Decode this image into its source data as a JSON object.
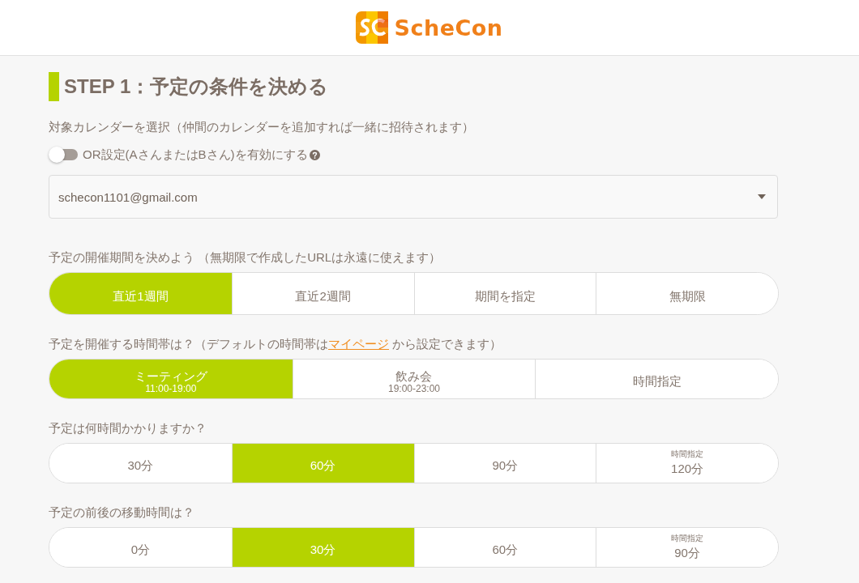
{
  "header": {
    "logo_text": "ScheCon"
  },
  "step": {
    "title": "STEP 1：予定の条件を決める"
  },
  "calendar": {
    "label": "対象カレンダーを選択（仲間のカレンダーを追加すれば一緒に招待されます）",
    "or_toggle": {
      "label": "OR設定(AさんまたはBさん)を有効にする",
      "on": false
    },
    "select": {
      "value": "schecon1101@gmail.com"
    }
  },
  "period": {
    "label": "予定の開催期間を決めよう （無期限で作成したURLは永遠に使えます）",
    "options": [
      {
        "label": "直近1週間",
        "selected": true
      },
      {
        "label": "直近2週間",
        "selected": false
      },
      {
        "label": "期間を指定",
        "selected": false
      },
      {
        "label": "無期限",
        "selected": false
      }
    ]
  },
  "time_slot": {
    "label_before": "予定を開催する時間帯は？（デフォルトの時間帯は",
    "link": "マイページ",
    "label_after": " から設定できます）",
    "options": [
      {
        "label": "ミーティング",
        "sub": "11:00-19:00",
        "selected": true
      },
      {
        "label": "飲み会",
        "sub": "19:00-23:00",
        "selected": false
      },
      {
        "label": "時間指定",
        "selected": false
      }
    ]
  },
  "duration": {
    "label": "予定は何時間かかりますか？",
    "options": [
      {
        "label": "30分",
        "selected": false
      },
      {
        "label": "60分",
        "selected": true
      },
      {
        "label": "90分",
        "selected": false
      },
      {
        "caption": "時間指定",
        "label": "120分",
        "selected": false
      }
    ]
  },
  "travel": {
    "label": "予定の前後の移動時間は？",
    "options": [
      {
        "label": "0分",
        "selected": false
      },
      {
        "label": "30分",
        "selected": true
      },
      {
        "label": "60分",
        "selected": false
      },
      {
        "caption": "時間指定",
        "label": "90分",
        "selected": false
      }
    ]
  }
}
